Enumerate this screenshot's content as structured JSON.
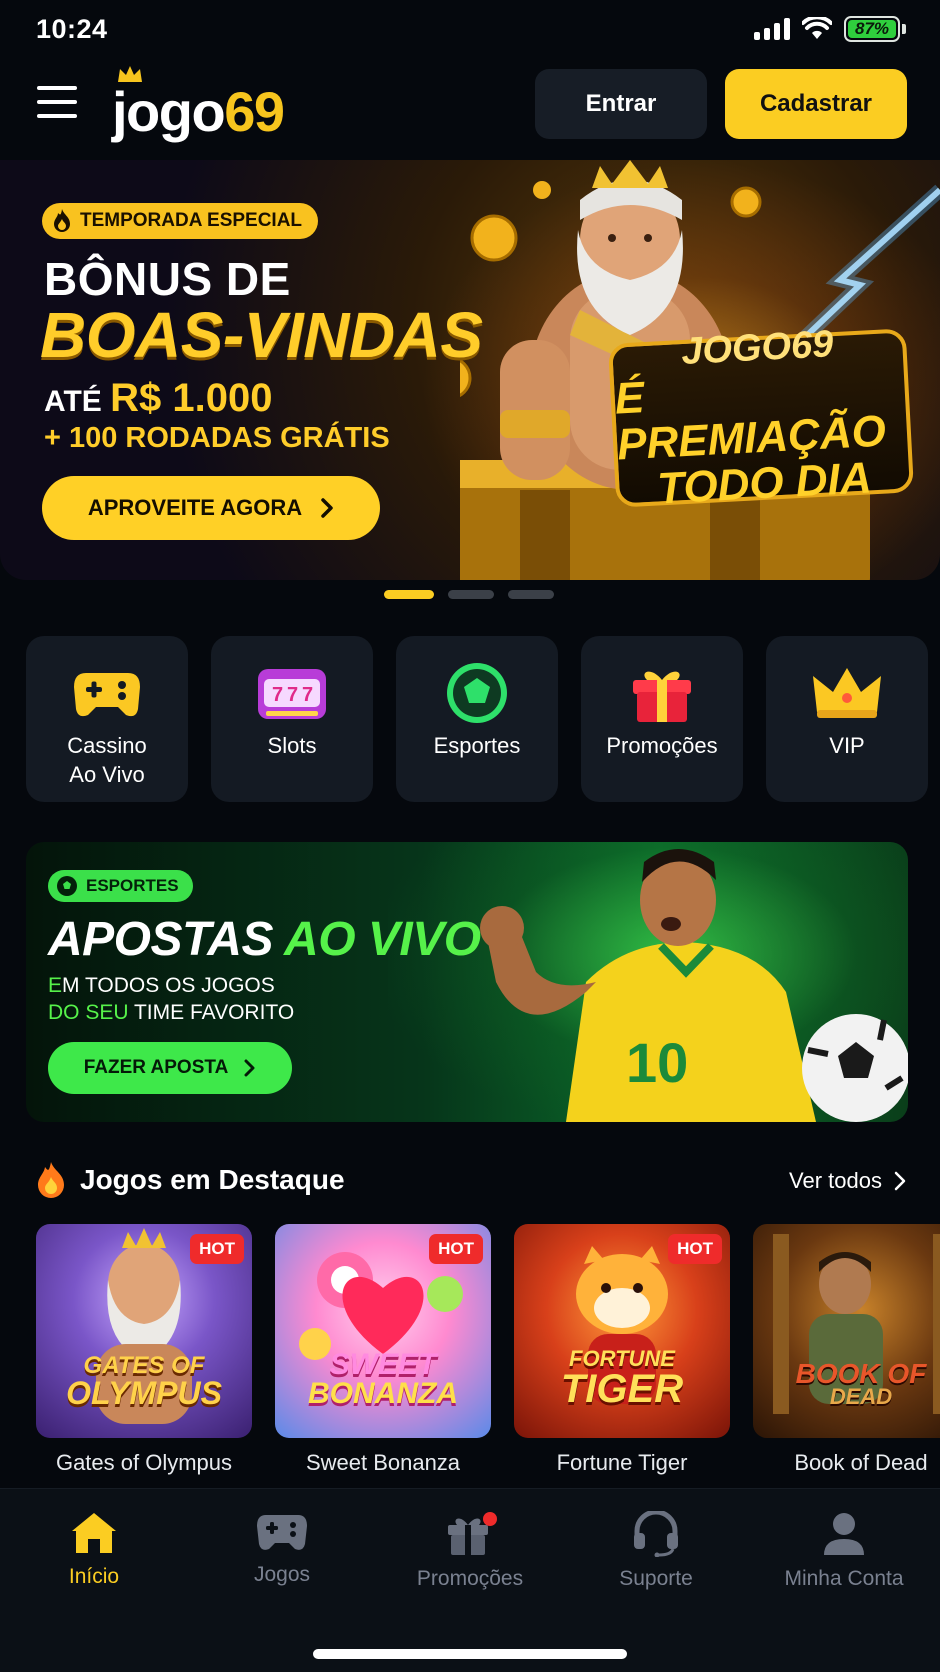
{
  "status_bar": {
    "time": "10:24",
    "battery": "87%"
  },
  "header": {
    "logo_main": "jogo",
    "logo_number": "69",
    "login_label": "Entrar",
    "signup_label": "Cadastrar"
  },
  "hero": {
    "badge": "TEMPORADA ESPECIAL",
    "title_line1": "BÔNUS DE",
    "title_line2": "BOAS-VINDAS",
    "sub_prefix": "ATÉ",
    "sub_amount": "R$ 1.000",
    "sub_line2": "+ 100 RODADAS GRÁTIS",
    "cta": "APROVEITE AGORA",
    "plaque_line1": "JOGO69",
    "plaque_line2": "É PREMIAÇÃO",
    "plaque_line3": "TODO DIA"
  },
  "carousel": {
    "total_slides": 3,
    "active_slide": 1
  },
  "categories": [
    {
      "label_line1": "Cassino",
      "label_line2": "Ao Vivo",
      "icon": "gamepad-icon"
    },
    {
      "label_line1": "Slots",
      "label_line2": "",
      "icon": "slot-machine-icon"
    },
    {
      "label_line1": "Esportes",
      "label_line2": "",
      "icon": "soccer-ball-icon"
    },
    {
      "label_line1": "Promoções",
      "label_line2": "",
      "icon": "gift-icon"
    },
    {
      "label_line1": "VIP",
      "label_line2": "",
      "icon": "crown-icon"
    }
  ],
  "sports_banner": {
    "badge": "ESPORTES",
    "title_white": "APOSTAS",
    "title_green": "AO VIVO",
    "sub_line1_green": "E",
    "sub_line1_rest": "M TODOS OS JOGOS",
    "sub_line2_green": "DO SEU",
    "sub_line2_rest": " TIME FAVORITO",
    "cta": "FAZER APOSTA",
    "jersey_number": "10"
  },
  "featured": {
    "title": "Jogos em Destaque",
    "see_all": "Ver todos",
    "games": [
      {
        "name": "Gates of Olympus",
        "thumb_line1": "GATES OF",
        "thumb_line2": "OLYMPUS",
        "badge": "HOT"
      },
      {
        "name": "Sweet Bonanza",
        "thumb_line1": "SWEET",
        "thumb_line2": "BONANZA",
        "badge": "HOT"
      },
      {
        "name": "Fortune Tiger",
        "thumb_line1": "FORTUNE",
        "thumb_line2": "TIGER",
        "badge": "HOT"
      },
      {
        "name": "Book of Dead",
        "thumb_line1": "BOOK OF",
        "thumb_line2": "DEAD",
        "badge": ""
      }
    ]
  },
  "bottom_nav": [
    {
      "label": "Início",
      "icon": "home-icon",
      "active": true
    },
    {
      "label": "Jogos",
      "icon": "gamepad-icon",
      "active": false
    },
    {
      "label": "Promoções",
      "icon": "gift-icon",
      "active": false,
      "notification_dot": true
    },
    {
      "label": "Suporte",
      "icon": "headset-icon",
      "active": false
    },
    {
      "label": "Minha Conta",
      "icon": "user-icon",
      "active": false
    }
  ],
  "colors": {
    "accent_yellow": "#fbcd22",
    "accent_green": "#3ee84a",
    "background": "#05080d",
    "card": "#141a23",
    "hot_red": "#ef2b2b"
  }
}
